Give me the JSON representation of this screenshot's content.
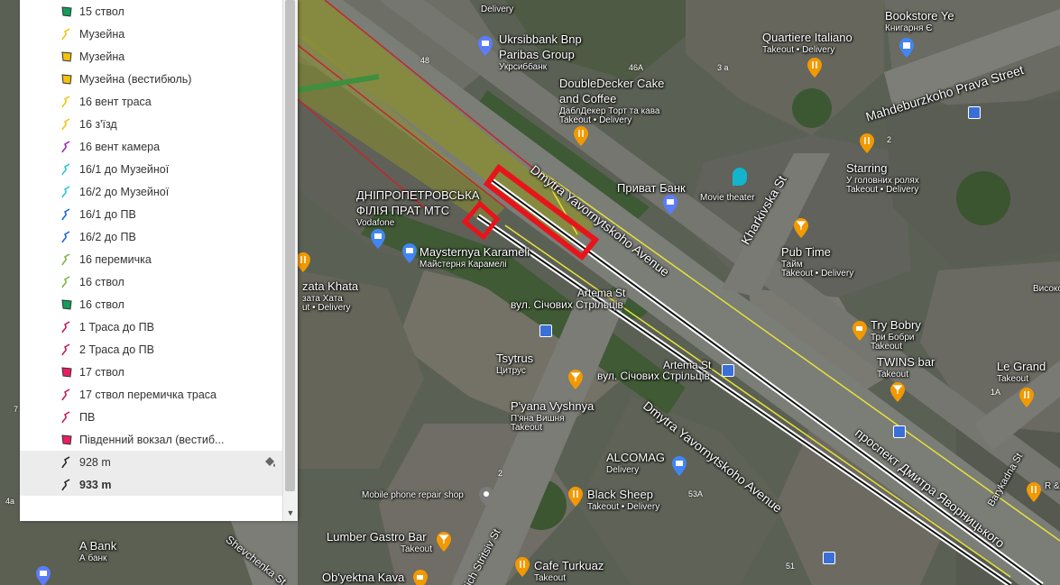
{
  "layers": [
    {
      "label": "15 ствол",
      "icon": "polygon-icon",
      "color": "#0f9d58"
    },
    {
      "label": "Музейна",
      "icon": "line-icon",
      "color": "#f4c20d"
    },
    {
      "label": "Музейна",
      "icon": "polygon-icon",
      "color": "#f4c20d"
    },
    {
      "label": "Музейна (вестибюль)",
      "icon": "polygon-icon",
      "color": "#f4c20d"
    },
    {
      "label": "16 вент траса",
      "icon": "line-icon",
      "color": "#f4c20d"
    },
    {
      "label": "16 з'їзд",
      "icon": "line-icon",
      "color": "#f4c20d"
    },
    {
      "label": "16 вент камера",
      "icon": "line-icon",
      "color": "#9c27b0"
    },
    {
      "label": "16/1 до Музейної",
      "icon": "line-icon",
      "color": "#26c6da"
    },
    {
      "label": "16/2 до Музейної",
      "icon": "line-icon",
      "color": "#26c6da"
    },
    {
      "label": "16/1 до ПВ",
      "icon": "line-icon",
      "color": "#1e63d6"
    },
    {
      "label": "16/2 до ПВ",
      "icon": "line-icon",
      "color": "#1e63d6"
    },
    {
      "label": "16 перемичка",
      "icon": "line-icon",
      "color": "#7cb342"
    },
    {
      "label": "16 ствол",
      "icon": "line-icon",
      "color": "#7cb342"
    },
    {
      "label": "16 ствол",
      "icon": "polygon-icon",
      "color": "#0f9d58"
    },
    {
      "label": "1 Траса до ПВ",
      "icon": "line-icon",
      "color": "#c2185b"
    },
    {
      "label": "2 Траса до ПВ",
      "icon": "line-icon",
      "color": "#c2185b"
    },
    {
      "label": "17 ствол",
      "icon": "polygon-icon",
      "color": "#e91e63"
    },
    {
      "label": "17 ствол перемичка траса",
      "icon": "line-icon",
      "color": "#c2185b"
    },
    {
      "label": "ПВ",
      "icon": "line-icon",
      "color": "#c2185b"
    },
    {
      "label": "Південний вокзал (вестиб...",
      "icon": "polygon-icon",
      "color": "#e91e63"
    },
    {
      "label": "928 m",
      "icon": "line-icon",
      "color": "#222222"
    },
    {
      "label": "933 m",
      "icon": "line-icon",
      "color": "#222222"
    }
  ],
  "map": {
    "streets": {
      "mahdeburzka": "Mahdeburzkoho Prava Street",
      "yavornytskoho_top": "Dmytra Yavornytskoho Avenue",
      "yavornytskoho_bottom": "Dmytra Yavornytskoho Avenue",
      "kharkivska": "Kharkivska St",
      "prospekt_ua": "проспект Дмитра Яворницького",
      "stritsiv": "Sich Stritsiv St",
      "shevchenka": "Shevchenka St",
      "barykadna": "Barykadna St",
      "artema_1": "Artema St",
      "artema_2": "Artema St",
      "sichovykh_1": "вул. Січових Стрільців",
      "sichovykh_2": "вул. Січових Стрільців"
    },
    "places": {
      "delivery_top": "Delivery",
      "ukrsibbank": "Ukrsibbank Bnp Paribas Group",
      "ukrsibbank_ua": "Укрсиббанк",
      "doubledecker": "DoubleDecker Cake and Coffee",
      "doubledecker_ua": "ДаблДекер Торт та кава",
      "doubledecker_sub": "Takeout • Delivery",
      "bookstore": "Bookstore Ye",
      "bookstore_ua": "Книгарня Є",
      "quartiere": "Quartiere Italiano",
      "quartiere_sub": "Takeout • Delivery",
      "privat": "Приват Банк",
      "movie": "Movie theater",
      "starring": "Starring",
      "starring_ua": "У головних ролях",
      "starring_sub": "Takeout • Delivery",
      "dnipro": "ДНІПРОПЕТРОВСЬКА ФІЛІЯ ПРАТ МТС",
      "dnipro_sub": "Vodafone",
      "maysternya": "Maysternya Karameli",
      "maysternya_ua": "Майстерня Карамелі",
      "pustime": "Pub Time",
      "pustime_ua": "Тайм",
      "pustime_sub": "Takeout • Delivery",
      "khata": "zata Khata",
      "khata_ua": "зата Хата",
      "khata_sub": "ut • Delivery",
      "trybobry": "Try Bobry",
      "trybobry_ua": "Три Бобри",
      "trybobry_sub": "Takeout",
      "twins": "TWINS bar",
      "twins_sub": "Takeout",
      "legrand": "Le Grand",
      "legrand_sub": "Takeout",
      "tsytrus": "Tsytrus",
      "tsytrus_ua": "Цитрус",
      "pyana": "P'yana Vyshnya",
      "pyana_ua": "П'яна Вишня",
      "pyana_sub": "Takeout",
      "alcomag": "ALCOMAG",
      "alcomag_sub": "Delivery",
      "blacksheep": "Black Sheep",
      "blacksheep_sub": "Takeout • Delivery",
      "mobile": "Mobile phone repair shop",
      "lumber": "Lumber Gastro Bar",
      "lumber_sub": "Takeout",
      "abank": "A Bank",
      "abank_ua": "А банк",
      "obyektna": "Ob'yektna Kava",
      "cafeturkuaz": "Cafe Turkuaz",
      "cafeturkuaz_sub": "Takeout",
      "vysoko": "Високо",
      "rg": "R & G"
    },
    "house_numbers": [
      "48",
      "46A",
      "3 a",
      "2",
      "1A",
      "53A",
      "51",
      "2",
      "4a",
      "7"
    ]
  },
  "colors": {
    "highlight_red": "#e8141c",
    "route_black": "#111111",
    "route_yellow": "#e7e23a",
    "olive": "#8a8f2e",
    "green_line": "#3f8f3f"
  }
}
